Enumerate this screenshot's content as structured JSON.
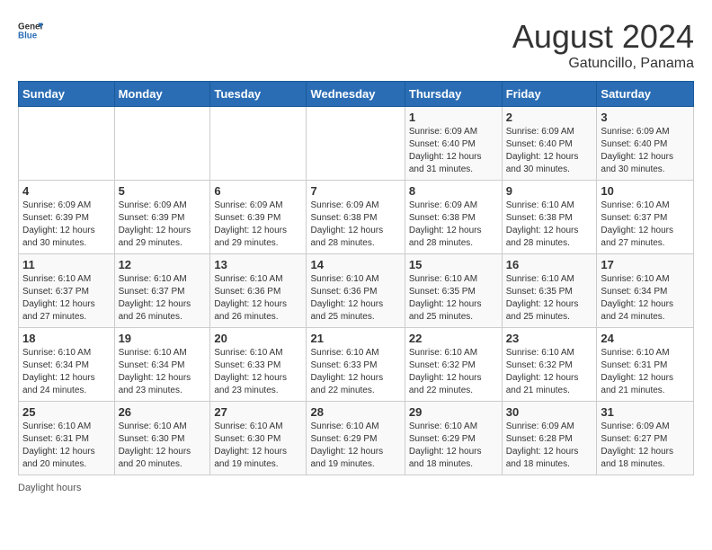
{
  "header": {
    "logo_general": "General",
    "logo_blue": "Blue",
    "month_year": "August 2024",
    "location": "Gatuncillo, Panama"
  },
  "weekdays": [
    "Sunday",
    "Monday",
    "Tuesday",
    "Wednesday",
    "Thursday",
    "Friday",
    "Saturday"
  ],
  "weeks": [
    [
      {
        "day": "",
        "info": ""
      },
      {
        "day": "",
        "info": ""
      },
      {
        "day": "",
        "info": ""
      },
      {
        "day": "",
        "info": ""
      },
      {
        "day": "1",
        "info": "Sunrise: 6:09 AM\nSunset: 6:40 PM\nDaylight: 12 hours\nand 31 minutes."
      },
      {
        "day": "2",
        "info": "Sunrise: 6:09 AM\nSunset: 6:40 PM\nDaylight: 12 hours\nand 30 minutes."
      },
      {
        "day": "3",
        "info": "Sunrise: 6:09 AM\nSunset: 6:40 PM\nDaylight: 12 hours\nand 30 minutes."
      }
    ],
    [
      {
        "day": "4",
        "info": "Sunrise: 6:09 AM\nSunset: 6:39 PM\nDaylight: 12 hours\nand 30 minutes."
      },
      {
        "day": "5",
        "info": "Sunrise: 6:09 AM\nSunset: 6:39 PM\nDaylight: 12 hours\nand 29 minutes."
      },
      {
        "day": "6",
        "info": "Sunrise: 6:09 AM\nSunset: 6:39 PM\nDaylight: 12 hours\nand 29 minutes."
      },
      {
        "day": "7",
        "info": "Sunrise: 6:09 AM\nSunset: 6:38 PM\nDaylight: 12 hours\nand 28 minutes."
      },
      {
        "day": "8",
        "info": "Sunrise: 6:09 AM\nSunset: 6:38 PM\nDaylight: 12 hours\nand 28 minutes."
      },
      {
        "day": "9",
        "info": "Sunrise: 6:10 AM\nSunset: 6:38 PM\nDaylight: 12 hours\nand 28 minutes."
      },
      {
        "day": "10",
        "info": "Sunrise: 6:10 AM\nSunset: 6:37 PM\nDaylight: 12 hours\nand 27 minutes."
      }
    ],
    [
      {
        "day": "11",
        "info": "Sunrise: 6:10 AM\nSunset: 6:37 PM\nDaylight: 12 hours\nand 27 minutes."
      },
      {
        "day": "12",
        "info": "Sunrise: 6:10 AM\nSunset: 6:37 PM\nDaylight: 12 hours\nand 26 minutes."
      },
      {
        "day": "13",
        "info": "Sunrise: 6:10 AM\nSunset: 6:36 PM\nDaylight: 12 hours\nand 26 minutes."
      },
      {
        "day": "14",
        "info": "Sunrise: 6:10 AM\nSunset: 6:36 PM\nDaylight: 12 hours\nand 25 minutes."
      },
      {
        "day": "15",
        "info": "Sunrise: 6:10 AM\nSunset: 6:35 PM\nDaylight: 12 hours\nand 25 minutes."
      },
      {
        "day": "16",
        "info": "Sunrise: 6:10 AM\nSunset: 6:35 PM\nDaylight: 12 hours\nand 25 minutes."
      },
      {
        "day": "17",
        "info": "Sunrise: 6:10 AM\nSunset: 6:34 PM\nDaylight: 12 hours\nand 24 minutes."
      }
    ],
    [
      {
        "day": "18",
        "info": "Sunrise: 6:10 AM\nSunset: 6:34 PM\nDaylight: 12 hours\nand 24 minutes."
      },
      {
        "day": "19",
        "info": "Sunrise: 6:10 AM\nSunset: 6:34 PM\nDaylight: 12 hours\nand 23 minutes."
      },
      {
        "day": "20",
        "info": "Sunrise: 6:10 AM\nSunset: 6:33 PM\nDaylight: 12 hours\nand 23 minutes."
      },
      {
        "day": "21",
        "info": "Sunrise: 6:10 AM\nSunset: 6:33 PM\nDaylight: 12 hours\nand 22 minutes."
      },
      {
        "day": "22",
        "info": "Sunrise: 6:10 AM\nSunset: 6:32 PM\nDaylight: 12 hours\nand 22 minutes."
      },
      {
        "day": "23",
        "info": "Sunrise: 6:10 AM\nSunset: 6:32 PM\nDaylight: 12 hours\nand 21 minutes."
      },
      {
        "day": "24",
        "info": "Sunrise: 6:10 AM\nSunset: 6:31 PM\nDaylight: 12 hours\nand 21 minutes."
      }
    ],
    [
      {
        "day": "25",
        "info": "Sunrise: 6:10 AM\nSunset: 6:31 PM\nDaylight: 12 hours\nand 20 minutes."
      },
      {
        "day": "26",
        "info": "Sunrise: 6:10 AM\nSunset: 6:30 PM\nDaylight: 12 hours\nand 20 minutes."
      },
      {
        "day": "27",
        "info": "Sunrise: 6:10 AM\nSunset: 6:30 PM\nDaylight: 12 hours\nand 19 minutes."
      },
      {
        "day": "28",
        "info": "Sunrise: 6:10 AM\nSunset: 6:29 PM\nDaylight: 12 hours\nand 19 minutes."
      },
      {
        "day": "29",
        "info": "Sunrise: 6:10 AM\nSunset: 6:29 PM\nDaylight: 12 hours\nand 18 minutes."
      },
      {
        "day": "30",
        "info": "Sunrise: 6:09 AM\nSunset: 6:28 PM\nDaylight: 12 hours\nand 18 minutes."
      },
      {
        "day": "31",
        "info": "Sunrise: 6:09 AM\nSunset: 6:27 PM\nDaylight: 12 hours\nand 18 minutes."
      }
    ]
  ],
  "footer": {
    "daylight_label": "Daylight hours"
  }
}
